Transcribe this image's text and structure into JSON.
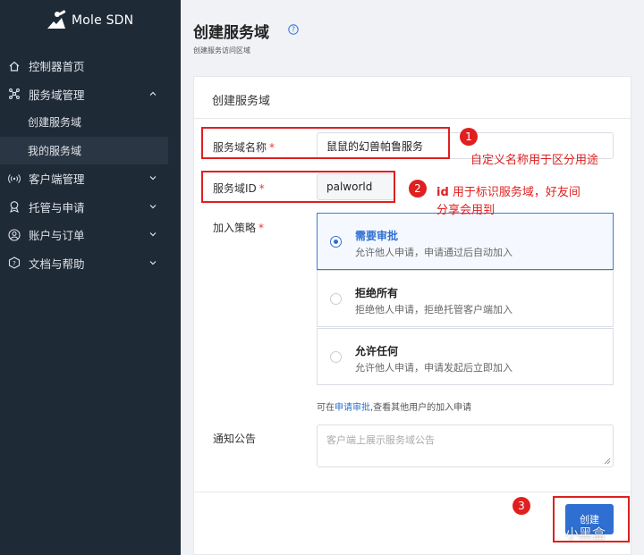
{
  "app": {
    "logo_text": "Mole SDN"
  },
  "sidebar": {
    "items": [
      {
        "label": "控制器首页",
        "icon": "home-icon"
      },
      {
        "label": "服务域管理",
        "icon": "cluster-icon"
      },
      {
        "label": "客户端管理",
        "icon": "signal-icon"
      },
      {
        "label": "托管与申请",
        "icon": "award-icon"
      },
      {
        "label": "账户与订单",
        "icon": "user-icon"
      },
      {
        "label": "文档与帮助",
        "icon": "question-icon"
      }
    ],
    "sub_items": [
      {
        "label": "创建服务域"
      },
      {
        "label": "我的服务域"
      }
    ]
  },
  "header": {
    "title": "创建服务域",
    "subtitle": "创建服务访问区域"
  },
  "card": {
    "title": "创建服务域",
    "name_label": "服务域名称",
    "name_value": "鼠鼠的幻兽帕鲁服务",
    "id_label": "服务域ID",
    "id_value": "palworld",
    "policy_label": "加入策略",
    "required_mark": "*",
    "options": [
      {
        "title": "需要审批",
        "desc": "允许他人申请，申请通过后自动加入"
      },
      {
        "title": "拒绝所有",
        "desc": "拒绝他人申请，拒绝托管客户端加入"
      },
      {
        "title": "允许任何",
        "desc": "允许他人申请，申请发起后立即加入"
      }
    ],
    "hint_prefix": "可在",
    "hint_link": "申请审批",
    "hint_suffix": ",查看其他用户的加入申请",
    "notice_label": "通知公告",
    "notice_placeholder": "客户端上展示服务域公告",
    "create_button": "创建"
  },
  "annotations": {
    "badge1": "1",
    "badge2": "2",
    "badge3": "3",
    "note1": "自定义名称用于区分用途",
    "note2_bold": "id",
    "note2_line1": " 用于标识服务域，好友间",
    "note2_line2": "分享会用到"
  },
  "watermark": "小黑盒",
  "colors": {
    "sidebar_bg": "#1f2a37",
    "accent": "#2f6fd1",
    "annotation_red": "#e01f1f"
  }
}
